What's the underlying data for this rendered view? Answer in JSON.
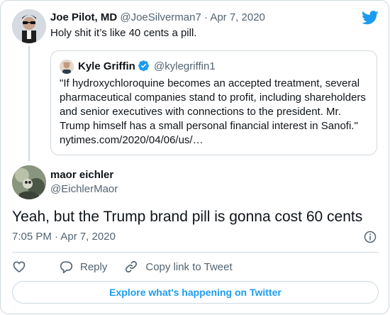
{
  "parent_tweet": {
    "author_name": "Joe Pilot, MD",
    "author_handle": "@JoeSilverman7",
    "separator": "·",
    "date": "Apr 7, 2020",
    "text": "Holy shit it’s like 40 cents a pill."
  },
  "quoted_tweet": {
    "author_name": "Kyle Griffin",
    "author_handle": "@kylegriffin1",
    "verified": true,
    "text": "\"If hydroxychloroquine becomes an accepted treatment, several pharmaceutical companies stand to profit, including shareholders and senior executives with connections to the president. Mr. Trump himself has a small personal financial interest in Sanofi.\"",
    "link": "nytimes.com/2020/04/06/us/…"
  },
  "main_tweet": {
    "author_name": "maor eichler",
    "author_handle": "@EichlerMaor",
    "text": "Yeah, but the Trump brand pill is gonna cost 60 cents",
    "timestamp": "7:05 PM · Apr 7, 2020"
  },
  "actions": {
    "reply_label": "Reply",
    "copy_link_label": "Copy link to Tweet"
  },
  "footer": {
    "explore_label": "Explore what's happening on Twitter"
  },
  "colors": {
    "brand": "#1d9bf0",
    "text": "#0f1419",
    "muted": "#536471",
    "border": "#cfd9de"
  },
  "icons": [
    "twitter-bird-icon",
    "verified-badge-icon",
    "info-icon",
    "heart-icon",
    "reply-icon",
    "link-icon"
  ]
}
